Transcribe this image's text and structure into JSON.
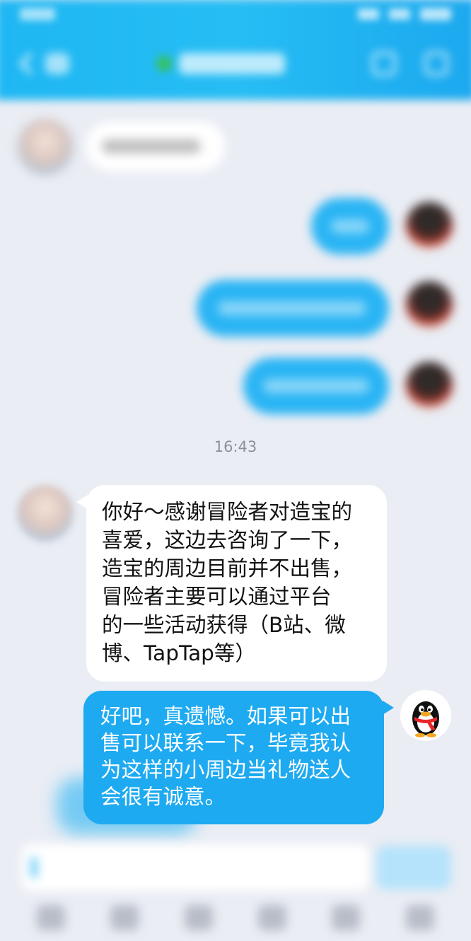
{
  "window": {
    "timestamp": "16:43"
  },
  "conversation": {
    "messages": [
      {
        "sender": "service",
        "text_lines": [
          "你好～感谢冒险者对造宝的",
          "喜爱，这边去咨询了一下，",
          "造宝的周边目前并不出售，",
          "冒险者主要可以通过平台",
          "的一些活动获得（B站、微",
          "博、TapTap等）"
        ]
      },
      {
        "sender": "me",
        "text_lines": [
          "好吧，真遗憾。如果可以出",
          "售可以联系一下，毕竟我认",
          "为这样的小周边当礼物送人",
          "会很有诚意。"
        ]
      }
    ]
  },
  "colors": {
    "header": "#26bdf4",
    "background": "#eaedf4",
    "outgoing_bubble": "#1eaaf1",
    "incoming_bubble": "#ffffff",
    "timestamp_text": "#8d9099"
  },
  "icons": {
    "back": "chevron-left-icon",
    "call": "phone-icon",
    "profile": "person-icon",
    "user_avatar": "qq-penguin-icon"
  }
}
